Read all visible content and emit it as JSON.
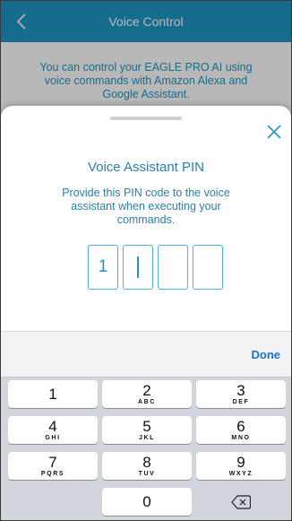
{
  "header": {
    "title": "Voice Control"
  },
  "background": {
    "description": "You can control your EAGLE PRO AI using voice commands with Amazon Alexa and Google Assistant."
  },
  "sheet": {
    "title": "Voice Assistant PIN",
    "subtitle": "Provide this PIN code to the voice assistant when executing your commands.",
    "pin_digits": [
      "1",
      "",
      "",
      ""
    ]
  },
  "keyboard": {
    "done_label": "Done",
    "keys": [
      {
        "digit": "1",
        "letters": ""
      },
      {
        "digit": "2",
        "letters": "ABC"
      },
      {
        "digit": "3",
        "letters": "DEF"
      },
      {
        "digit": "4",
        "letters": "GHI"
      },
      {
        "digit": "5",
        "letters": "JKL"
      },
      {
        "digit": "6",
        "letters": "MNO"
      },
      {
        "digit": "7",
        "letters": "PQRS"
      },
      {
        "digit": "8",
        "letters": "TUV"
      },
      {
        "digit": "9",
        "letters": "WXYZ"
      },
      {
        "digit": "0",
        "letters": ""
      }
    ]
  },
  "colors": {
    "accent": "#1f96c6",
    "done": "#1b72d1",
    "keypad_bg": "#d2d5db"
  }
}
